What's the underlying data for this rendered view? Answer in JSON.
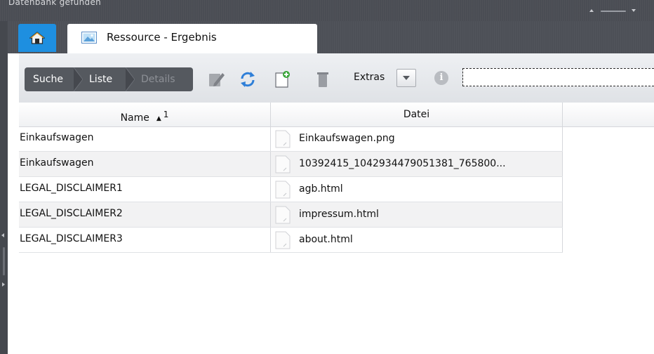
{
  "window": {
    "status_text": "Datenbank gefunden",
    "tabs": [
      {
        "label": "",
        "icon": "home-icon"
      },
      {
        "label": "Ressource - Ergebnis",
        "icon": "image-icon"
      }
    ]
  },
  "toolbar": {
    "breadcrumb": [
      "Suche",
      "Liste",
      "Details"
    ],
    "extras_label": "Extras",
    "search_placeholder": "",
    "search_value": "",
    "icons": [
      "edit-icon",
      "refresh-icon",
      "new-document-icon",
      "delete-icon",
      "dropdown-arrow-icon",
      "info-icon"
    ]
  },
  "table": {
    "columns": [
      {
        "label": "Name",
        "sort_direction": "ascending",
        "sort_index": "1"
      },
      {
        "label": "Datei"
      }
    ],
    "rows": [
      {
        "name": "Einkaufswagen",
        "file": "Einkaufswagen.png"
      },
      {
        "name": "Einkaufswagen",
        "file": "10392415_1042934479051381_765800..."
      },
      {
        "name": "LEGAL_DISCLAIMER1",
        "file": "agb.html"
      },
      {
        "name": "LEGAL_DISCLAIMER2",
        "file": "impressum.html"
      },
      {
        "name": "LEGAL_DISCLAIMER3",
        "file": "about.html"
      }
    ]
  },
  "colors": {
    "accent": "#1e8fe0",
    "chrome_dark": "#4d5057",
    "breadcrumb_bg": "#55595f",
    "refresh_blue": "#2f7fd8",
    "new_doc_green": "#3aa53a"
  }
}
